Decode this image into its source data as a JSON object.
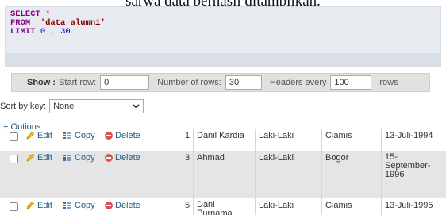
{
  "caption": "sarwa data berhasil ditampilkan.",
  "sql": {
    "select_kw": "SELECT",
    "star": "*",
    "from_kw": "FROM",
    "table": "'data_alumni'",
    "limit_kw": "LIMIT",
    "offset": "0",
    "comma": ",",
    "count": "30"
  },
  "nav": {
    "show_label": "Show :",
    "start_row_label": "Start row:",
    "start_row_value": "0",
    "num_rows_label": "Number of rows:",
    "num_rows_value": "30",
    "headers_every_label": "Headers every",
    "headers_every_value": "100",
    "rows_label": "rows"
  },
  "sort": {
    "label": "Sort by key:",
    "value": "None"
  },
  "options_label": "+ Options",
  "actions": {
    "edit": "Edit",
    "copy": "Copy",
    "delete": "Delete"
  },
  "rows": [
    {
      "id": "1",
      "name": "Danil Kardia",
      "gender": "Laki-Laki",
      "city": "Ciamis",
      "date": "13-Juli-1994"
    },
    {
      "id": "3",
      "name": "Ahmad",
      "gender": "Laki-Laki",
      "city": "Bogor",
      "date": "15-\nSeptember-\n1996"
    },
    {
      "id": "5",
      "name": "Dani\nPurnama",
      "gender": "Laki-Laki",
      "city": "Ciamis",
      "date": "13-Juli-1995"
    }
  ],
  "colors": {
    "sql_bg": "#e7ebf0",
    "row_alt": "#e5e5e5",
    "link": "#235a81",
    "keyword": "#8b0085"
  }
}
